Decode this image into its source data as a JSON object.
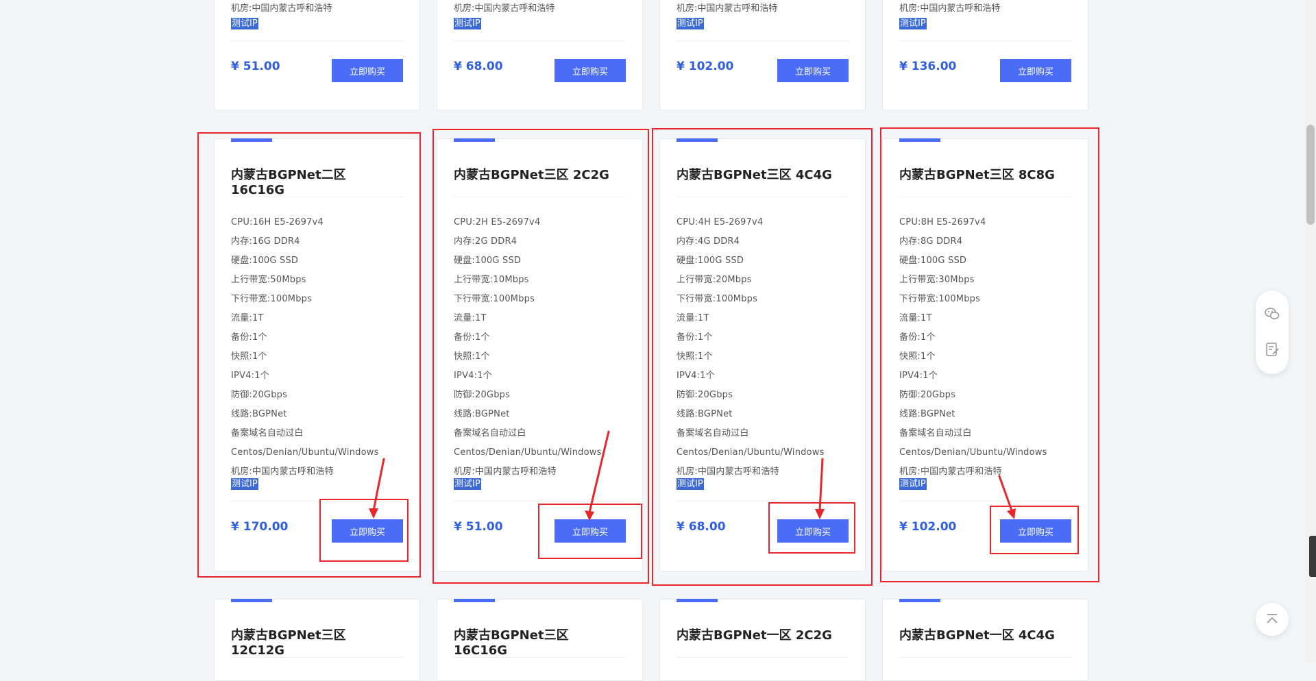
{
  "common": {
    "buy_label": "立即购买",
    "test_ip": "测试IP",
    "location": "机房:中国内蒙古呼和浩特"
  },
  "top_row": [
    {
      "price": "¥ 51.00"
    },
    {
      "price": "¥ 68.00"
    },
    {
      "price": "¥ 102.00"
    },
    {
      "price": "¥ 136.00"
    }
  ],
  "middle_row": [
    {
      "title": "内蒙古BGPNet二区 16C16G",
      "specs": [
        "CPU:16H E5-2697v4",
        "内存:16G DDR4",
        "硬盘:100G SSD",
        "上行带宽:50Mbps",
        "下行带宽:100Mbps",
        "流量:1T",
        "备份:1个",
        "快照:1个",
        "IPV4:1个",
        "防御:20Gbps",
        "线路:BGPNet",
        "备案域名自动过白",
        "Centos/Denian/Ubuntu/Windows",
        "机房:中国内蒙古呼和浩特"
      ],
      "price": "¥ 170.00"
    },
    {
      "title": "内蒙古BGPNet三区 2C2G",
      "specs": [
        "CPU:2H E5-2697v4",
        "内存:2G DDR4",
        "硬盘:100G SSD",
        "上行带宽:10Mbps",
        "下行带宽:100Mbps",
        "流量:1T",
        "备份:1个",
        "快照:1个",
        "IPV4:1个",
        "防御:20Gbps",
        "线路:BGPNet",
        "备案域名自动过白",
        "Centos/Denian/Ubuntu/Windows",
        "机房:中国内蒙古呼和浩特"
      ],
      "price": "¥ 51.00"
    },
    {
      "title": "内蒙古BGPNet三区 4C4G",
      "specs": [
        "CPU:4H E5-2697v4",
        "内存:4G DDR4",
        "硬盘:100G SSD",
        "上行带宽:20Mbps",
        "下行带宽:100Mbps",
        "流量:1T",
        "备份:1个",
        "快照:1个",
        "IPV4:1个",
        "防御:20Gbps",
        "线路:BGPNet",
        "备案域名自动过白",
        "Centos/Denian/Ubuntu/Windows",
        "机房:中国内蒙古呼和浩特"
      ],
      "price": "¥ 68.00"
    },
    {
      "title": "内蒙古BGPNet三区 8C8G",
      "specs": [
        "CPU:8H E5-2697v4",
        "内存:8G DDR4",
        "硬盘:100G SSD",
        "上行带宽:30Mbps",
        "下行带宽:100Mbps",
        "流量:1T",
        "备份:1个",
        "快照:1个",
        "IPV4:1个",
        "防御:20Gbps",
        "线路:BGPNet",
        "备案域名自动过白",
        "Centos/Denian/Ubuntu/Windows",
        "机房:中国内蒙古呼和浩特"
      ],
      "price": "¥ 102.00"
    }
  ],
  "bottom_row": [
    {
      "title": "内蒙古BGPNet三区 12C12G"
    },
    {
      "title": "内蒙古BGPNet三区 16C16G"
    },
    {
      "title": "内蒙古BGPNet一区 2C2G"
    },
    {
      "title": "内蒙古BGPNet一区 4C4G"
    }
  ],
  "side_panel": {
    "icons": [
      "wechat-icon",
      "notes-icon"
    ],
    "back_to_top_icon": "arrow-up-icon"
  },
  "colors": {
    "accent": "#4a6cf7",
    "price": "#2f5fe0",
    "highlight_box": "#e8262b"
  }
}
